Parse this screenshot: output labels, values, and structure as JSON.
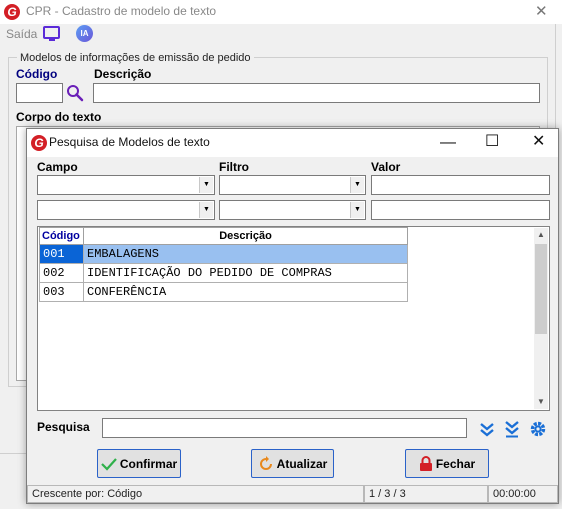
{
  "main_window": {
    "title": "CPR - Cadastro de modelo de texto",
    "menu": {
      "saida": "Saída"
    },
    "group_title": "Modelos de informações de emissão de pedido",
    "codigo_label": "Código",
    "descricao_label": "Descrição",
    "corpo_label": "Corpo do texto",
    "codigo_value": "",
    "descricao_value": "",
    "ia_label": "IA"
  },
  "dialog": {
    "title": "Pesquisa de Modelos de texto",
    "filter_headers": {
      "campo": "Campo",
      "filtro": "Filtro",
      "valor": "Valor"
    },
    "filters": [
      {
        "campo": "",
        "filtro": "",
        "valor": ""
      },
      {
        "campo": "",
        "filtro": "",
        "valor": ""
      }
    ],
    "grid": {
      "columns": [
        "Código",
        "Descrição"
      ],
      "rows": [
        {
          "codigo": "001",
          "descricao": "EMBALAGENS"
        },
        {
          "codigo": "002",
          "descricao": "IDENTIFICAÇÃO DO PEDIDO DE COMPRAS"
        },
        {
          "codigo": "003",
          "descricao": "CONFERÊNCIA"
        }
      ],
      "selected_index": 0
    },
    "pesquisa_label": "Pesquisa",
    "pesquisa_value": "",
    "buttons": {
      "confirmar": "Confirmar",
      "atualizar": "Atualizar",
      "fechar": "Fechar"
    },
    "status": {
      "ordem": "Crescente por: Código",
      "contador": "1 / 3 / 3",
      "tempo": "00:00:00"
    }
  },
  "colors": {
    "brand_red": "#d31f26",
    "selection_blue": "#0a64d6",
    "selection_light": "#99c0f0",
    "icon_blue": "#1a6fd6",
    "label_blue": "#00007f"
  },
  "icons": [
    "app-logo",
    "monitor-icon",
    "ia-icon",
    "search-icon",
    "check-icon",
    "refresh-icon",
    "lock-icon",
    "chevron-down-icon",
    "double-chevron-down-icon",
    "gear-icon"
  ]
}
